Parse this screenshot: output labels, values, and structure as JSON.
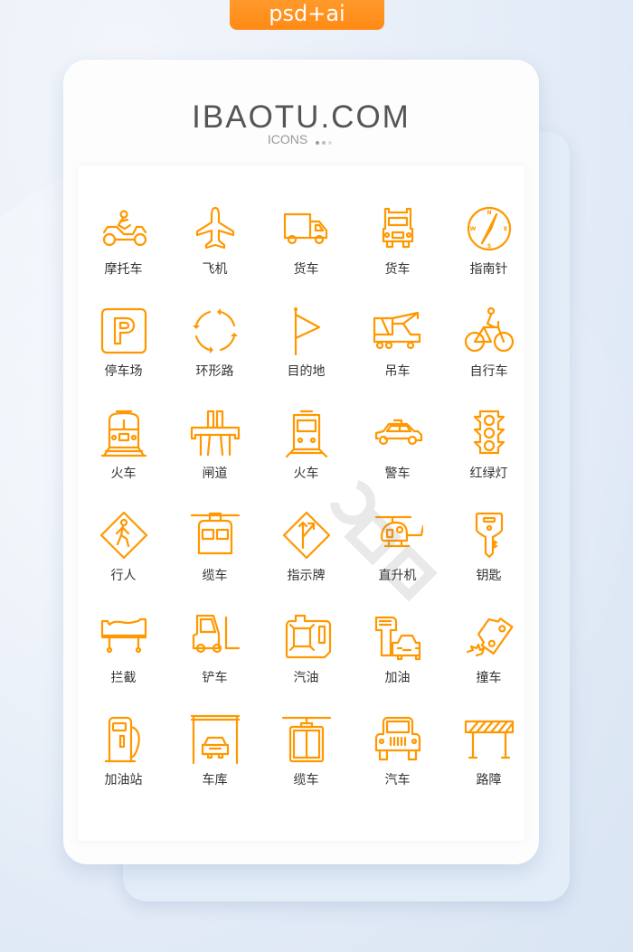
{
  "badge": {
    "label": "psd+ai",
    "color": "#ff8c1a"
  },
  "header": {
    "title": "IBAOTU.COM",
    "subtitle": "ICONS",
    "dot_colors": [
      "#9a9a9a",
      "#bbbbbb",
      "#dddddd"
    ]
  },
  "icon_color": "#ff9800",
  "icons": [
    {
      "name": "motorcycle-icon",
      "label": "摩托车"
    },
    {
      "name": "airplane-icon",
      "label": "飞机"
    },
    {
      "name": "truck-icon",
      "label": "货车"
    },
    {
      "name": "semi-truck-icon",
      "label": "货车"
    },
    {
      "name": "compass-icon",
      "label": "指南针",
      "letters": [
        "N",
        "E",
        "S",
        "W"
      ]
    },
    {
      "name": "parking-icon",
      "label": "停车场",
      "letter": "P"
    },
    {
      "name": "roundabout-icon",
      "label": "环形路"
    },
    {
      "name": "flag-icon",
      "label": "目的地"
    },
    {
      "name": "crane-truck-icon",
      "label": "吊车"
    },
    {
      "name": "bicycle-icon",
      "label": "自行车"
    },
    {
      "name": "train-icon",
      "label": "火车"
    },
    {
      "name": "toll-gate-icon",
      "label": "闸道"
    },
    {
      "name": "subway-icon",
      "label": "火车"
    },
    {
      "name": "police-car-icon",
      "label": "警车"
    },
    {
      "name": "traffic-light-icon",
      "label": "红绿灯"
    },
    {
      "name": "pedestrian-sign-icon",
      "label": "行人"
    },
    {
      "name": "cable-car-icon",
      "label": "缆车"
    },
    {
      "name": "direction-sign-icon",
      "label": "指示牌"
    },
    {
      "name": "helicopter-icon",
      "label": "直升机"
    },
    {
      "name": "key-icon",
      "label": "钥匙"
    },
    {
      "name": "barrier-icon",
      "label": "拦截"
    },
    {
      "name": "forklift-icon",
      "label": "铲车"
    },
    {
      "name": "fuel-can-icon",
      "label": "汽油"
    },
    {
      "name": "refuel-icon",
      "label": "加油"
    },
    {
      "name": "car-crash-icon",
      "label": "撞车"
    },
    {
      "name": "gas-station-icon",
      "label": "加油站"
    },
    {
      "name": "garage-icon",
      "label": "车库"
    },
    {
      "name": "gondola-icon",
      "label": "缆车"
    },
    {
      "name": "jeep-icon",
      "label": "汽车"
    },
    {
      "name": "roadblock-icon",
      "label": "路障"
    }
  ]
}
